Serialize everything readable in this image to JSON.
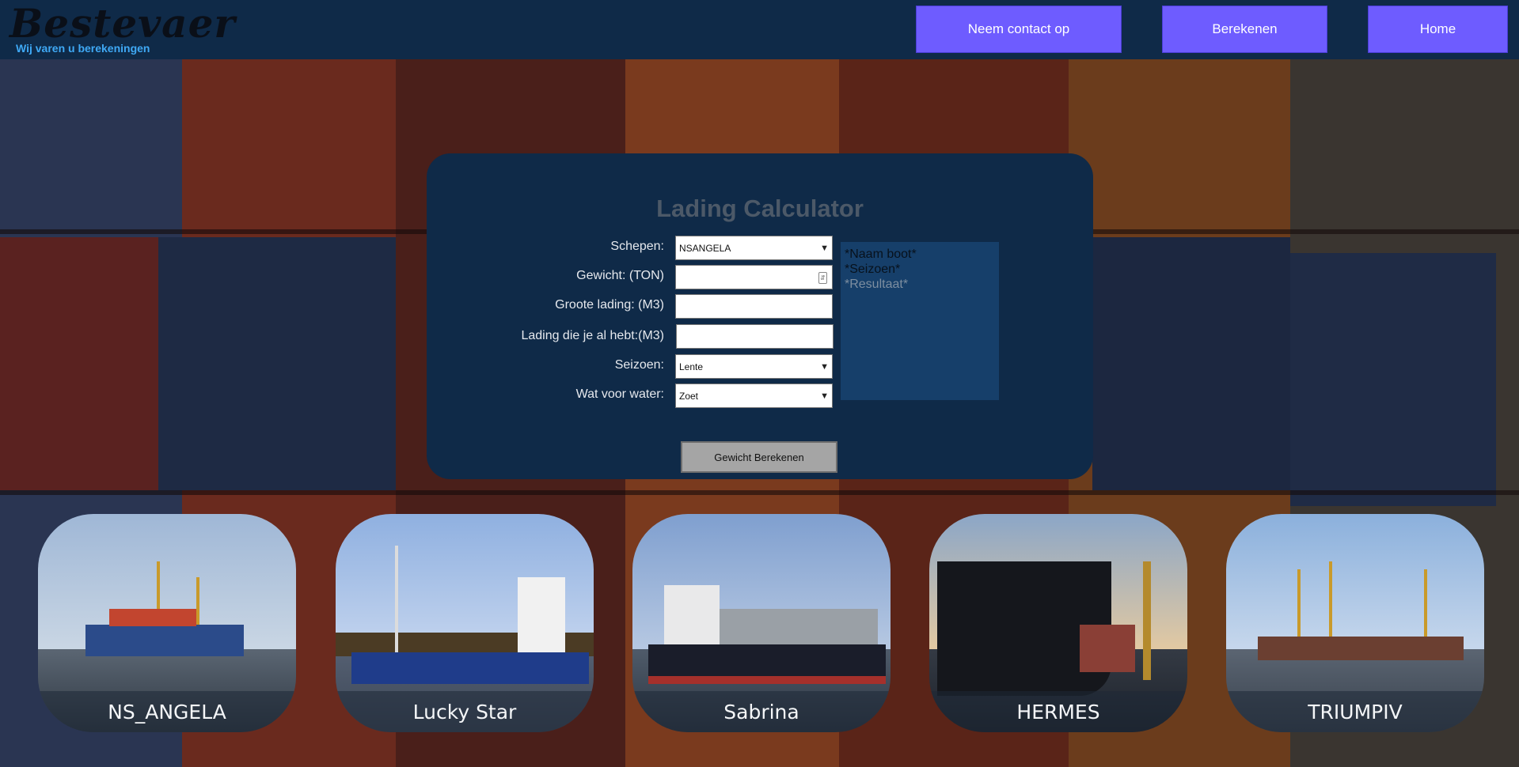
{
  "header": {
    "logo_title": "Bestevaer",
    "logo_subtitle": "Wij varen u berekeningen",
    "nav": [
      {
        "label": "Neem contact op"
      },
      {
        "label": "Berekenen"
      },
      {
        "label": "Home"
      }
    ]
  },
  "calculator": {
    "title": "Lading Calculator",
    "fields": {
      "schepen": {
        "label": "Schepen:",
        "value": "NSANGELA"
      },
      "gewicht": {
        "label": "Gewicht: (TON)",
        "value": ""
      },
      "groote": {
        "label": "Groote lading: (M3)",
        "value": ""
      },
      "al_hebt": {
        "label": "Lading die je al hebt:(M3)",
        "value": ""
      },
      "seizoen": {
        "label": "Seizoen:",
        "value": "Lente"
      },
      "water": {
        "label": "Wat voor water:",
        "value": "Zoet"
      }
    },
    "results": {
      "naam_boot": "*Naam boot*",
      "seizoen": "*Seizoen*",
      "resultaat": "*Resultaat*"
    },
    "button_label": "Gewicht Berekenen"
  },
  "ships": [
    {
      "name": "NS_ANGELA"
    },
    {
      "name": "Lucky Star"
    },
    {
      "name": "Sabrina"
    },
    {
      "name": "HERMES"
    },
    {
      "name": "TRIUMPIV"
    }
  ],
  "colors": {
    "header_bg": "#0f2a48",
    "nav_button": "#6e5cff",
    "card_bg": "#0f2a48",
    "result_bg": "#163f6a",
    "logo_sub": "#3fa9f5"
  }
}
